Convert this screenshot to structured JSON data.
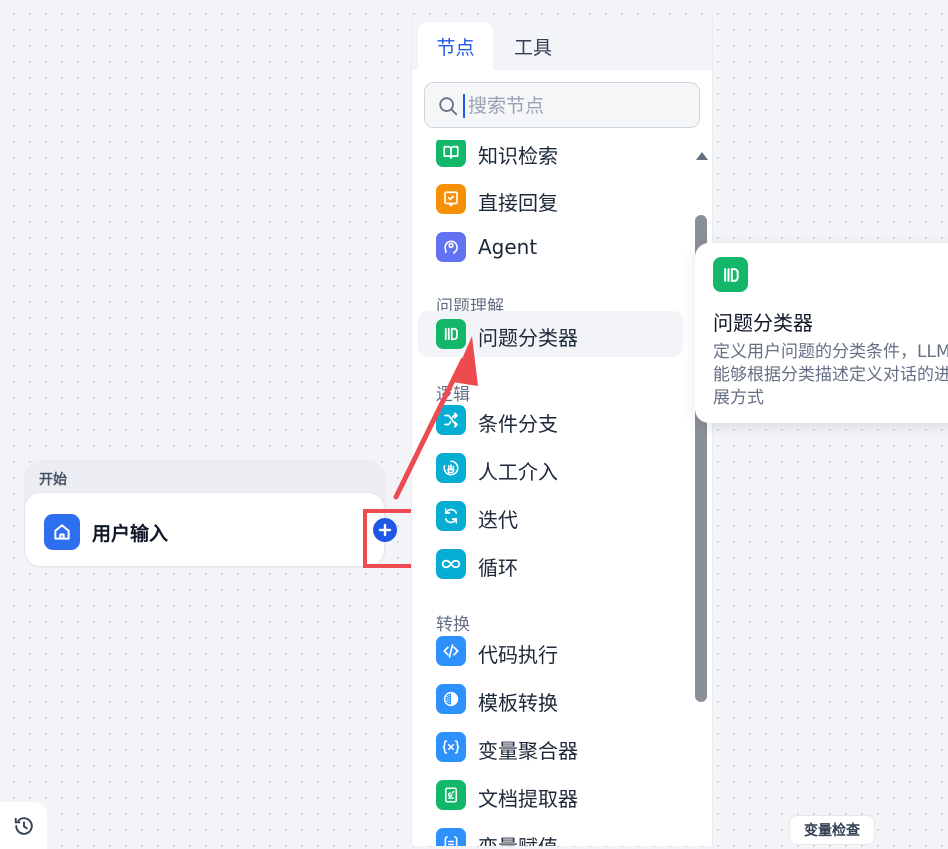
{
  "canvas": {
    "start_node": {
      "label": "开始",
      "title": "用户输入"
    }
  },
  "panel": {
    "tabs": [
      {
        "label": "节点",
        "active": true
      },
      {
        "label": "工具",
        "active": false
      }
    ],
    "search": {
      "placeholder": "搜索节点"
    },
    "items": {
      "knowledge": "知识检索",
      "answer": "直接回复",
      "agent": "Agent",
      "classifier": "问题分类器",
      "ifelse": "条件分支",
      "human": "人工介入",
      "iteration": "迭代",
      "loop": "循环",
      "code": "代码执行",
      "template": "模板转换",
      "aggregator": "变量聚合器",
      "doc": "文档提取器",
      "assigner": "变量赋值"
    },
    "sections": {
      "understanding": "问题理解",
      "logic": "逻辑",
      "transform": "转换"
    }
  },
  "tooltip": {
    "title": "问题分类器",
    "description": "定义用户问题的分类条件，LLM 能够根据分类描述定义对话的进展方式"
  },
  "footer": {
    "var_inspect": "变量检查"
  },
  "colors": {
    "green": "#12b76a",
    "orange": "#f79009",
    "indigo": "#6172f3",
    "cyan": "#06aed4",
    "blue": "#2e90fa",
    "brand": "#2058e8",
    "annotation": "#ee4b50"
  }
}
